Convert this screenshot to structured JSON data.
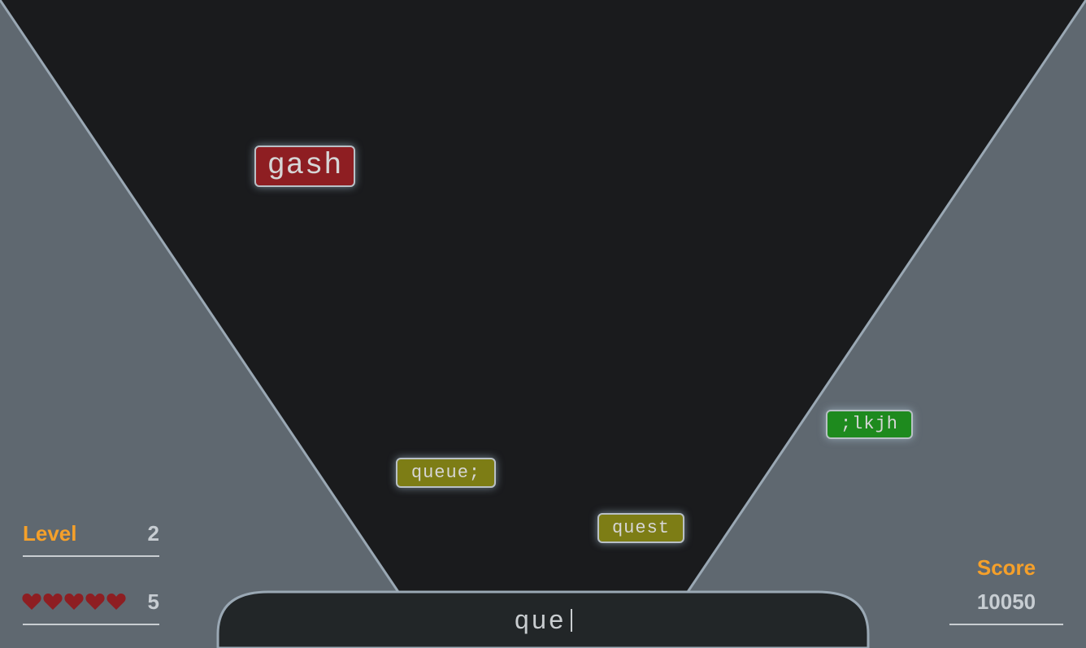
{
  "words": [
    {
      "id": "gash",
      "text": "gash",
      "state": "danger"
    },
    {
      "id": "queue",
      "text": "queue;",
      "state": "warning"
    },
    {
      "id": "quest",
      "text": "quest",
      "state": "warning"
    },
    {
      "id": "lkjh",
      "text": ";lkjh",
      "state": "safe"
    }
  ],
  "hud": {
    "level_label": "Level",
    "level_value": "2",
    "lives_value": "5",
    "lives_icon": "heart-icon",
    "hearts_count": 5,
    "score_label": "Score",
    "score_value": "10050"
  },
  "input": {
    "typed": "que"
  },
  "colors": {
    "background": "#1a1b1d",
    "walls": "#5f6870",
    "wall_edge": "#9aa8b4",
    "accent": "#f5a02a",
    "danger": "#8e1e22",
    "warning": "#7d7d15",
    "safe": "#1e8a1e",
    "heart": "#8e1e22"
  }
}
